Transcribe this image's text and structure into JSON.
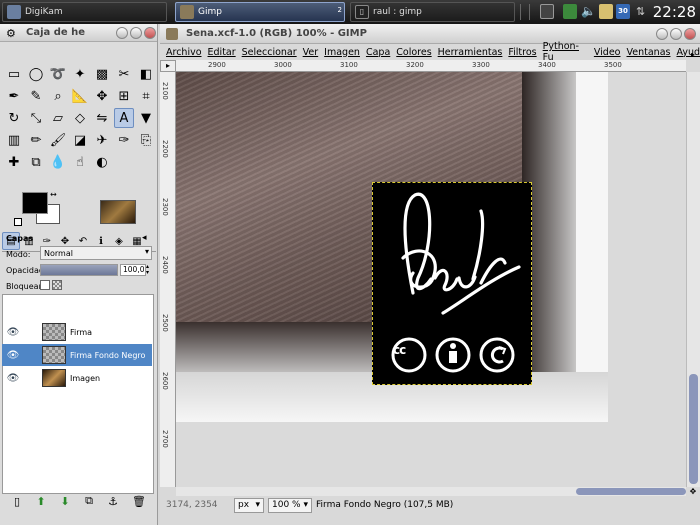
{
  "taskbar": {
    "tasks": [
      {
        "label": "DigiKam"
      },
      {
        "label": "Gimp",
        "badge": "2"
      },
      {
        "label": "raul : gimp"
      }
    ],
    "calendar_day": "30",
    "clock": "22:28",
    "colors": {
      "active": "#263450",
      "panel": "#1a1a1a"
    }
  },
  "toolbox": {
    "title": "Caja de he",
    "tools": [
      "rect-select",
      "ellipse-select",
      "free-select",
      "fuzzy-select",
      "color-select",
      "scissors",
      "foreground-select",
      "paths",
      "color-picker",
      "zoom",
      "measure",
      "move",
      "align",
      "crop",
      "rotate",
      "scale",
      "shear",
      "perspective",
      "flip",
      "text",
      "bucket-fill",
      "blend",
      "pencil",
      "paintbrush",
      "eraser",
      "airbrush",
      "ink",
      "clone",
      "heal",
      "perspective-clone",
      "blur",
      "smudge",
      "dodge-burn"
    ],
    "colors": {
      "foreground": "#000000",
      "background": "#ffffff"
    },
    "layers_panel": {
      "title": "Capas",
      "mode_label": "Modo:",
      "mode_value": "Normal",
      "opacity_label": "Opacidad:",
      "opacity_value": "100,0",
      "opacity_fraction": 1.0,
      "lock_label": "Bloquear:",
      "layers": [
        {
          "name": "Firma",
          "visible": true,
          "selected": false
        },
        {
          "name": "Firma Fondo Negro",
          "visible": true,
          "selected": true
        },
        {
          "name": "Imagen",
          "visible": true,
          "selected": false
        }
      ]
    }
  },
  "image_window": {
    "title": "Sena.xcf-1.0 (RGB) 100% - GIMP",
    "menu": [
      "Archivo",
      "Editar",
      "Seleccionar",
      "Ver",
      "Imagen",
      "Capa",
      "Colores",
      "Herramientas",
      "Filtros",
      "Python-Fu",
      "Video",
      "Ventanas",
      "Ayud"
    ],
    "ruler_h": [
      "2900",
      "3000",
      "3100",
      "3200",
      "3300",
      "3400",
      "3500"
    ],
    "ruler_v": [
      "2100",
      "2200",
      "2300",
      "2400",
      "2500",
      "2600",
      "2700"
    ],
    "status": {
      "coords": "3174, 2354",
      "unit": "px",
      "zoom": "100 %",
      "info": "Firma Fondo Negro (107,5 MB)"
    },
    "signature_text": "Raul"
  }
}
